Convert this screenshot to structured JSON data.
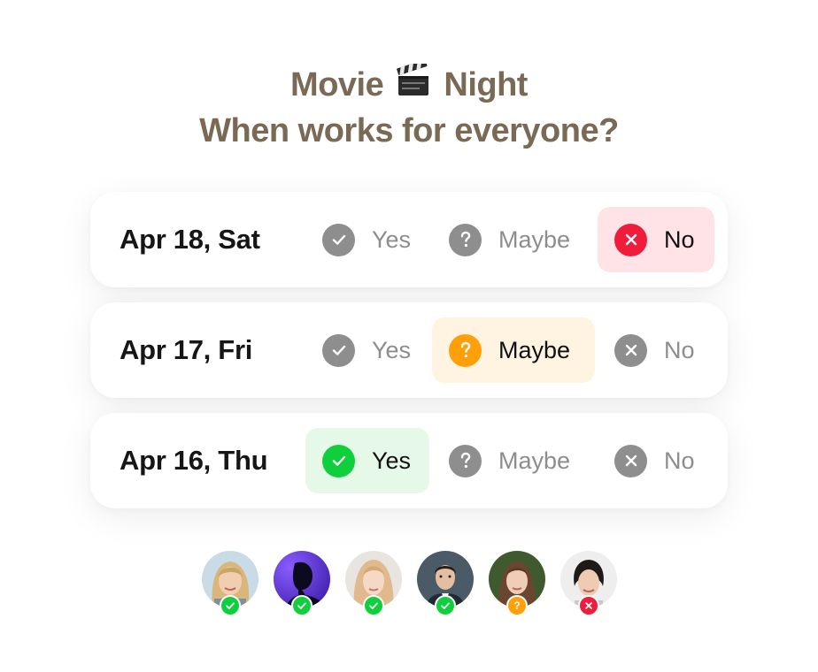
{
  "title": {
    "line1_before": "Movie",
    "emoji_icon": "clapper-board-icon",
    "line1_after": "Night",
    "line2": "When works for everyone?"
  },
  "options": {
    "yes": "Yes",
    "maybe": "Maybe",
    "no": "No"
  },
  "rows": [
    {
      "date": "Apr 18, Sat",
      "selected": "no"
    },
    {
      "date": "Apr 17, Fri",
      "selected": "maybe"
    },
    {
      "date": "Apr 16, Thu",
      "selected": "yes"
    }
  ],
  "participants": [
    {
      "avatar": "avatar-blonde-woman",
      "status": "yes"
    },
    {
      "avatar": "avatar-silhouette-purple",
      "status": "yes"
    },
    {
      "avatar": "avatar-redhead-woman",
      "status": "yes"
    },
    {
      "avatar": "avatar-man-suit",
      "status": "yes"
    },
    {
      "avatar": "avatar-brunette-woman",
      "status": "maybe"
    },
    {
      "avatar": "avatar-dark-hair-woman",
      "status": "no"
    }
  ],
  "colors": {
    "title": "#7a6a55",
    "yes": "#0fcf3c",
    "maybe": "#ff9f0a",
    "no": "#f01c3c",
    "neutral_icon": "#8e8e8e"
  }
}
